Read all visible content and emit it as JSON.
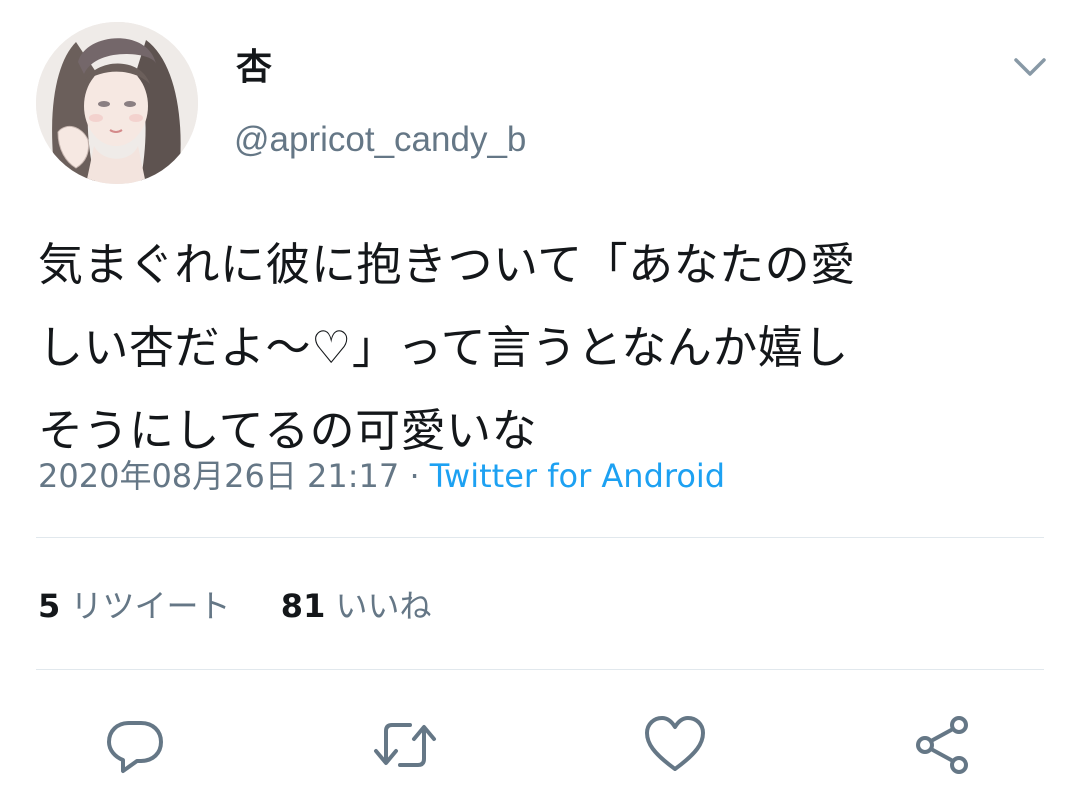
{
  "user": {
    "display_name": "杏",
    "handle": "@apricot_candy_b",
    "avatar_icon": "avatar-illustration"
  },
  "tweet": {
    "text": "気まぐれに彼に抱きついて「あなたの愛\nしい杏だよ〜♡」って言うとなんか嬉し\nそうにしてるの可愛いな",
    "timestamp": "2020年08月26日 21:17",
    "separator": " · ",
    "source": "Twitter for Android"
  },
  "stats": {
    "retweets_count": "5",
    "retweets_label": "リツイート",
    "likes_count": "81",
    "likes_label": "いいね"
  },
  "actions": {
    "reply_icon": "reply-icon",
    "retweet_icon": "retweet-icon",
    "like_icon": "heart-icon",
    "share_icon": "share-icon"
  },
  "colors": {
    "text": "#14171a",
    "secondary": "#657786",
    "link": "#1da1f2",
    "divider": "#e1e8ed"
  }
}
